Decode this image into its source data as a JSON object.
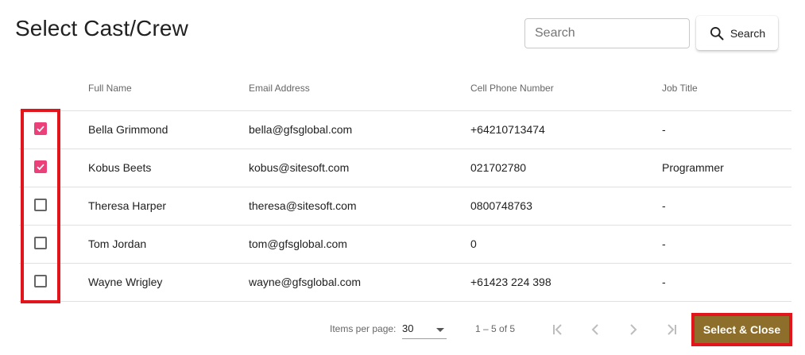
{
  "header": {
    "title": "Select Cast/Crew",
    "search_placeholder": "Search",
    "search_button_label": "Search"
  },
  "table": {
    "columns": {
      "name": "Full Name",
      "email": "Email Address",
      "phone": "Cell Phone Number",
      "job": "Job Title"
    },
    "rows": [
      {
        "checked": true,
        "name": "Bella Grimmond",
        "email": "bella@gfsglobal.com",
        "phone": "+64210713474",
        "job": "-"
      },
      {
        "checked": true,
        "name": "Kobus Beets",
        "email": "kobus@sitesoft.com",
        "phone": "021702780",
        "job": "Programmer"
      },
      {
        "checked": false,
        "name": "Theresa Harper",
        "email": "theresa@sitesoft.com",
        "phone": "0800748763",
        "job": "-"
      },
      {
        "checked": false,
        "name": "Tom Jordan",
        "email": "tom@gfsglobal.com",
        "phone": "0",
        "job": "-"
      },
      {
        "checked": false,
        "name": "Wayne Wrigley",
        "email": "wayne@gfsglobal.com",
        "phone": "+61423 224 398",
        "job": "-"
      }
    ]
  },
  "paginator": {
    "items_per_page_label": "Items per page:",
    "items_per_page_value": "30",
    "range_label": "1 – 5 of 5"
  },
  "footer": {
    "select_close_label": "Select & Close"
  },
  "colors": {
    "accent_checkbox": "#ec407a",
    "primary_button": "#8e6e2b",
    "annotation_highlight": "#e2151c"
  }
}
